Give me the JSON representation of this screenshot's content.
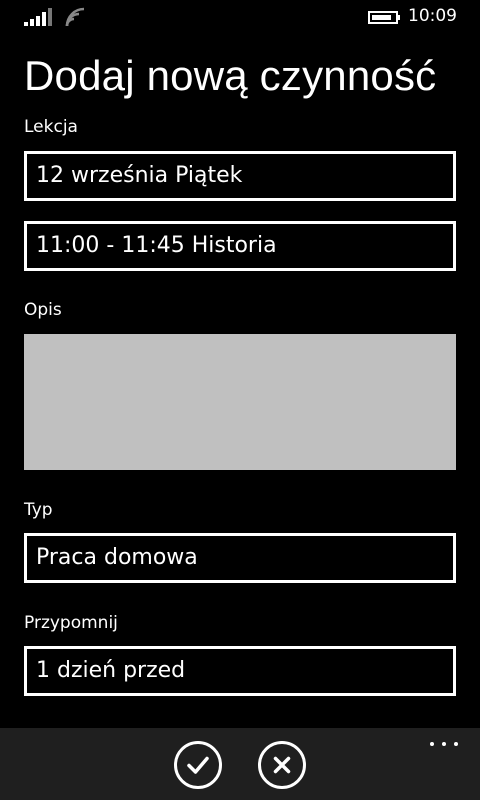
{
  "status_bar": {
    "time": "10:09",
    "icons": [
      "signal-icon",
      "wifi-icon",
      "battery-icon"
    ]
  },
  "page": {
    "title": "Dodaj nową czynność"
  },
  "form": {
    "lesson_label": "Lekcja",
    "date_value": "12 września Piątek",
    "lesson_value": "11:00 - 11:45 Historia",
    "description_label": "Opis",
    "description_value": "",
    "type_label": "Typ",
    "type_value": "Praca domowa",
    "reminder_label": "Przypomnij",
    "reminder_value": "1 dzień przed"
  },
  "app_bar": {
    "icons": [
      "check-icon",
      "close-icon",
      "more-icon"
    ],
    "background": "#1f1f1f"
  },
  "colors": {
    "background": "#000000",
    "foreground": "#ffffff",
    "textarea": "#c0c0c0"
  }
}
